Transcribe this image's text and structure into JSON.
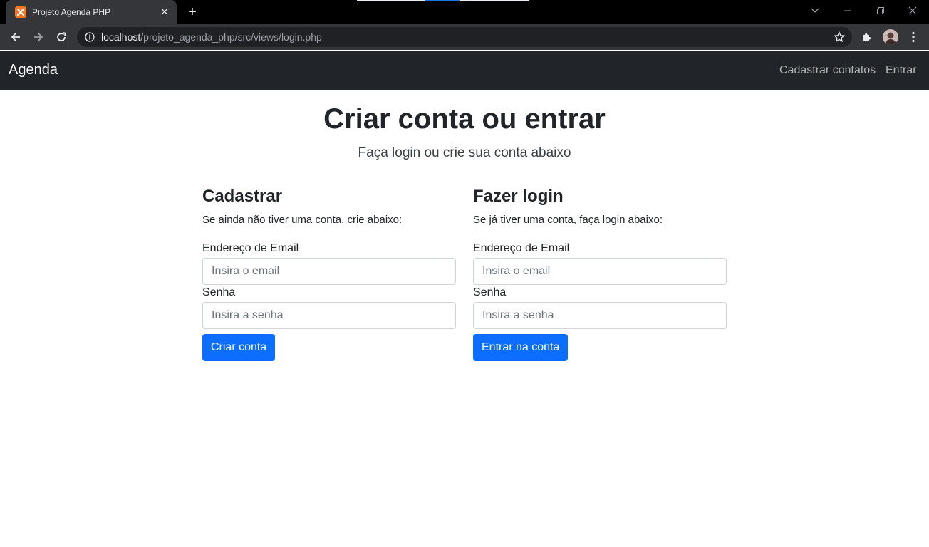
{
  "browser": {
    "tab_title": "Projeto Agenda PHP",
    "url_host": "localhost",
    "url_path": "/projeto_agenda_php/src/views/login.php"
  },
  "navbar": {
    "brand": "Agenda",
    "links": [
      "Cadastrar contatos",
      "Entrar"
    ]
  },
  "hero": {
    "title": "Criar conta ou entrar",
    "subtitle": "Faça login ou crie sua conta abaixo"
  },
  "register": {
    "heading": "Cadastrar",
    "description": "Se ainda não tiver uma conta, crie abaixo:",
    "email_label": "Endereço de Email",
    "email_placeholder": "Insira o email",
    "password_label": "Senha",
    "password_placeholder": "Insira a senha",
    "button": "Criar conta"
  },
  "login": {
    "heading": "Fazer login",
    "description": "Se já tiver uma conta, faça login abaixo:",
    "email_label": "Endereço de Email",
    "email_placeholder": "Insira o email",
    "password_label": "Senha",
    "password_placeholder": "Insira a senha",
    "button": "Entrar na conta"
  },
  "colors": {
    "navbar_bg": "#212529",
    "primary": "#0d6efd",
    "chrome_bg": "#35363a"
  }
}
